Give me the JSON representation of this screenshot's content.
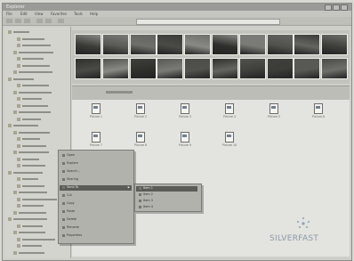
{
  "window": {
    "title": "Explorer",
    "menus": [
      "File",
      "Edit",
      "View",
      "Favorites",
      "Tools",
      "Help"
    ]
  },
  "files": [
    {
      "name": "Picture 1"
    },
    {
      "name": "Picture 2"
    },
    {
      "name": "Picture 3"
    },
    {
      "name": "Picture 4"
    },
    {
      "name": "Picture 5"
    },
    {
      "name": "Picture 6"
    },
    {
      "name": "Picture 7"
    },
    {
      "name": "Picture 8"
    },
    {
      "name": "Picture 9"
    },
    {
      "name": "Picture 10"
    }
  ],
  "context_menu": {
    "items": [
      {
        "label": "Open"
      },
      {
        "label": "Explore"
      },
      {
        "label": "Search..."
      },
      {
        "label": "Sharing"
      },
      {
        "label": "Send To"
      },
      {
        "label": "Cut"
      },
      {
        "label": "Copy"
      },
      {
        "label": "Paste"
      },
      {
        "label": "Delete"
      },
      {
        "label": "Rename"
      },
      {
        "label": "Properties"
      }
    ]
  },
  "submenu": {
    "items": [
      {
        "label": "Item 1"
      },
      {
        "label": "Item 2"
      },
      {
        "label": "Item 3"
      },
      {
        "label": "Item 4"
      }
    ]
  },
  "logo": {
    "text": "SILVERFAST"
  },
  "colors": {
    "background": "#d9d9d4",
    "menu": "#b2b2ad",
    "highlight": "#5b5b57"
  }
}
